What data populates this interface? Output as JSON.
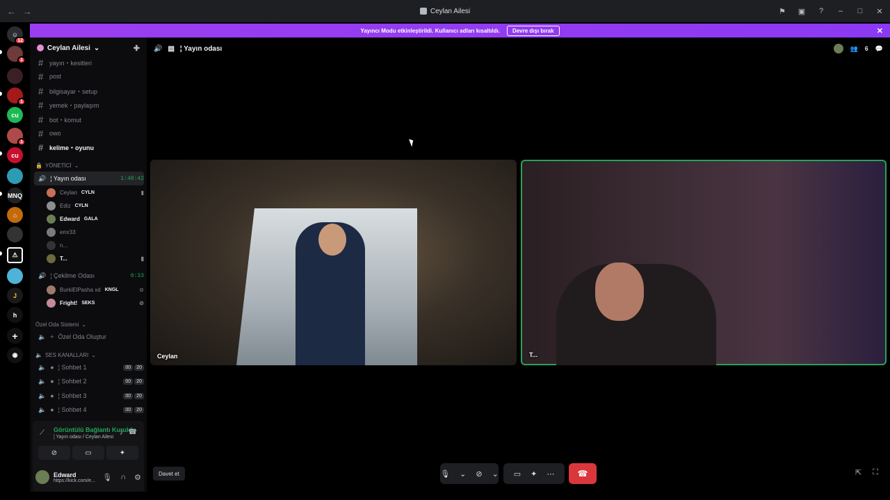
{
  "window": {
    "title": "Ceylan Ailesi"
  },
  "banner": {
    "text": "Yayıncı Modu etkinleştirildi. Kullanıcı adları kısaltıldı.",
    "button": "Devre dışı bırak"
  },
  "servers": {
    "badges": [
      "12",
      "1",
      "1",
      "1"
    ]
  },
  "guild": {
    "name": "Ceylan Ailesi"
  },
  "channels": [
    {
      "label": "yayın・kesitleri"
    },
    {
      "label": "post"
    },
    {
      "label": "bilgisayar・setup"
    },
    {
      "label": "yemek・paylaşım"
    },
    {
      "label": "bot・komut"
    },
    {
      "label": "owo"
    },
    {
      "label": "kelime・oyunu"
    }
  ],
  "categories": {
    "yonetici": "YÖNETİCİ",
    "ozel": "Özel Oda Sistemi",
    "ses": "SES KANALLARI"
  },
  "voice_channels": {
    "yayin": {
      "label": "¦ Yayın odası",
      "timer": "1:48:42"
    },
    "cekilme": {
      "label": "¦ Çekilme Odası",
      "timer": "0:33"
    },
    "ozel_olustur": {
      "label": "Özel Oda Oluştur"
    },
    "sohbet": [
      {
        "label": "¦ Sohbet 1",
        "a": "00",
        "b": "20"
      },
      {
        "label": "¦ Sohbet 2",
        "a": "00",
        "b": "20"
      },
      {
        "label": "¦ Sohbet 3",
        "a": "00",
        "b": "20"
      },
      {
        "label": "¦ Sohbet 4",
        "a": "00",
        "b": "20"
      }
    ]
  },
  "yayin_users": [
    {
      "name": "Ceylan",
      "tag": "CYLN",
      "color": "#c96f5a"
    },
    {
      "name": "Ediz",
      "tag": "CYLN",
      "color": "#8e8e8e"
    },
    {
      "name": "Edward",
      "tag": "GALA",
      "color": "#6b7d54"
    },
    {
      "name": "emr33",
      "tag": "",
      "color": "#7a7a7a"
    },
    {
      "name": "n...",
      "tag": "",
      "color": "#333"
    },
    {
      "name": "T...",
      "tag": "",
      "color": "#6b6b40"
    }
  ],
  "cekilme_users": [
    {
      "name": "BurkiElPasha xd",
      "tag": "KNGL",
      "color": "#9e7b6a"
    },
    {
      "name": "Fright!",
      "tag": "SEKS",
      "color": "#c48a9a"
    }
  ],
  "voice_panel": {
    "status": "Görüntülü Bağlantı Kuruldu",
    "sub": "¦ Yayın odası / Ceylan Ailesi"
  },
  "user": {
    "name": "Edward",
    "status": "https://kick.com/e..."
  },
  "main": {
    "channel": "¦ Yayın odası",
    "members": "6"
  },
  "tiles": {
    "left": "Ceylan",
    "right": "T..."
  },
  "controls": {
    "invite": "Davet et"
  },
  "colors": {
    "accent": "#8c39f3",
    "speaking": "#23a559",
    "hangup": "#da373c"
  }
}
